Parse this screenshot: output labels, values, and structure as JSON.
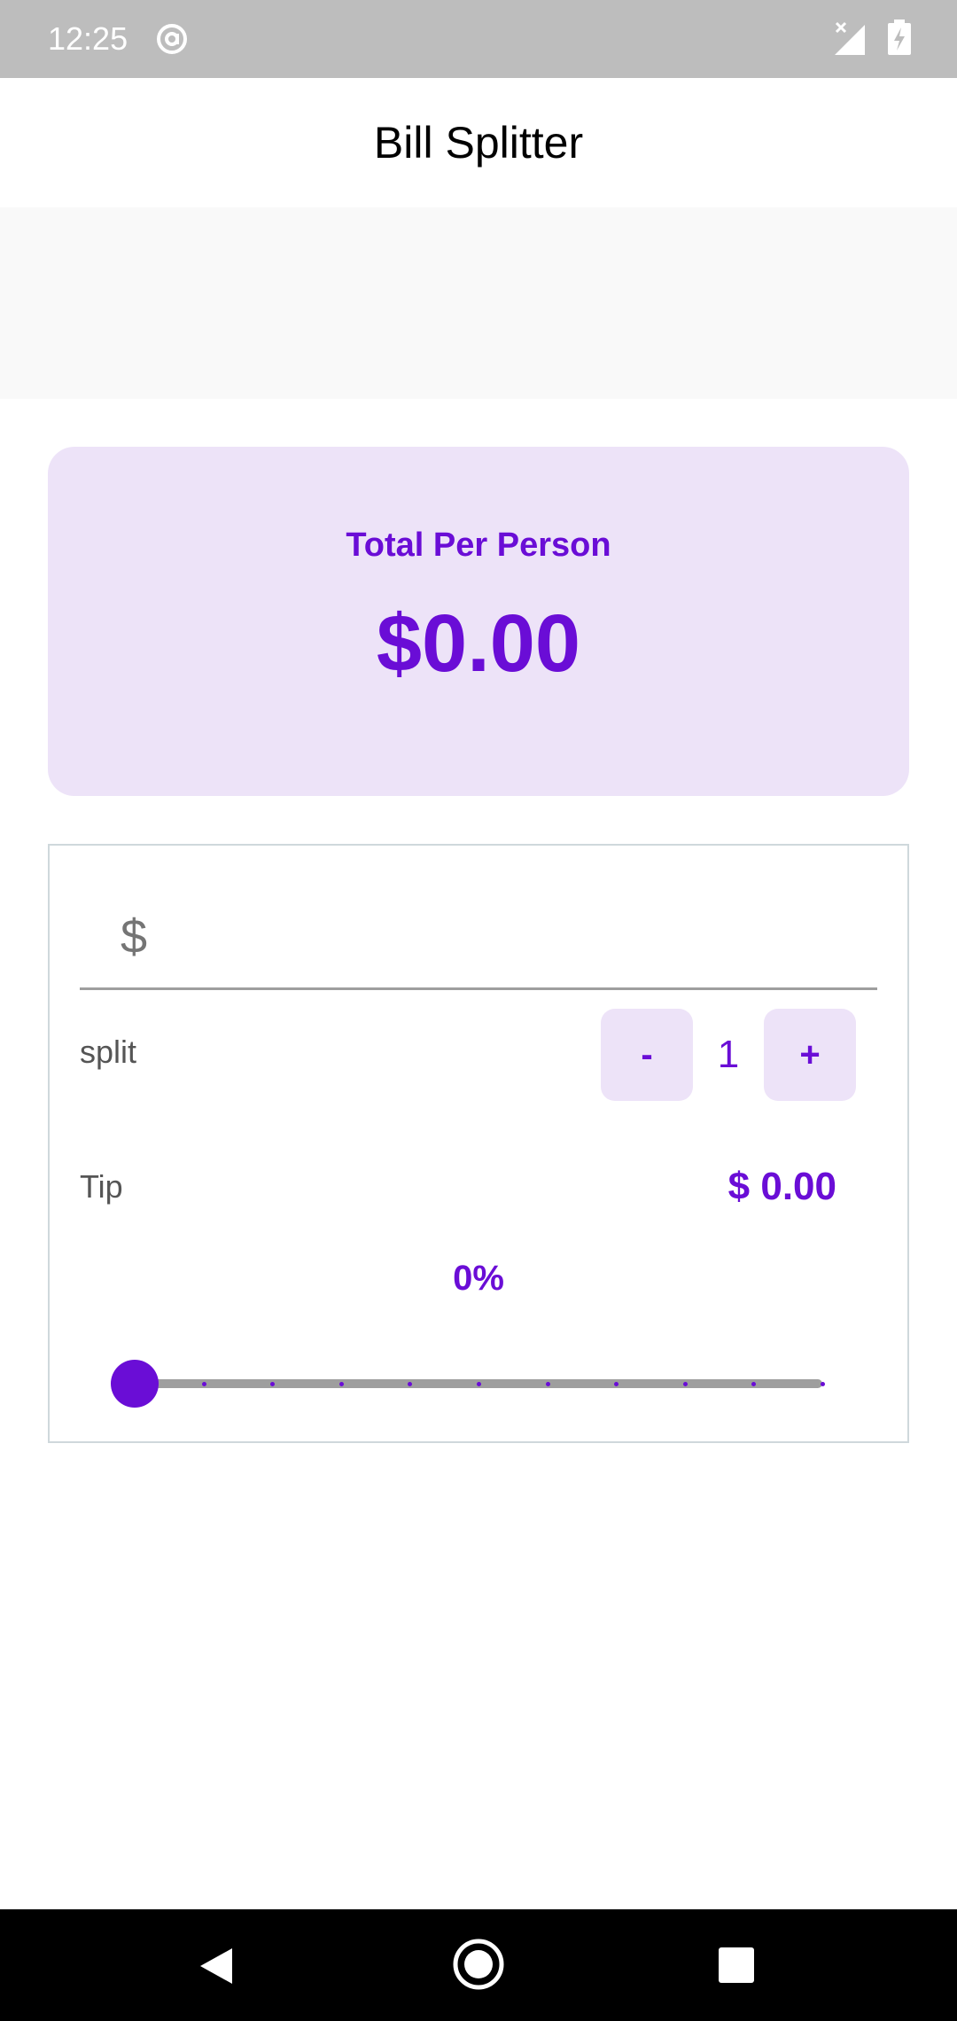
{
  "status_bar": {
    "time": "12:25",
    "icons": [
      "at-sign-icon",
      "signal-off-icon",
      "battery-charging-icon"
    ]
  },
  "app_bar": {
    "title": "Bill Splitter"
  },
  "total_card": {
    "label": "Total Per Person",
    "amount": "$0.00"
  },
  "bill_input": {
    "prefix": "$",
    "value": "",
    "placeholder": ""
  },
  "split": {
    "label": "split",
    "decrement_label": "-",
    "count": "1",
    "increment_label": "+"
  },
  "tip": {
    "label": "Tip",
    "amount": "$ 0.00",
    "percent_label": "0%",
    "slider_value": 0,
    "slider_min": 0,
    "slider_max": 100,
    "slider_divisions": 10
  },
  "colors": {
    "accent": "#6a0dd6",
    "card_background": "#ede3f8",
    "status_bar": "#bdbdbd"
  },
  "nav_bar": {
    "icons": [
      "back-icon",
      "home-icon",
      "recents-icon"
    ]
  }
}
